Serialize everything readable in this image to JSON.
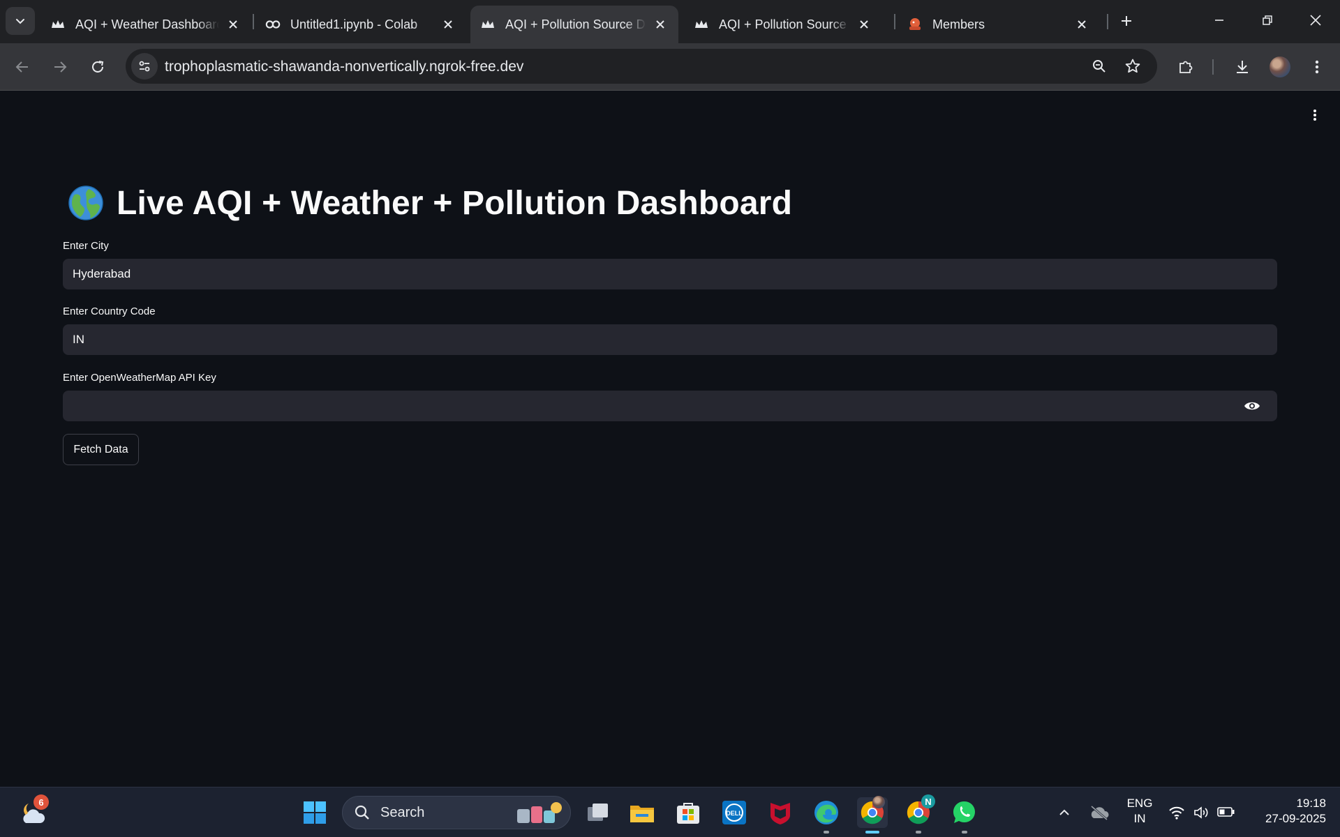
{
  "browser": {
    "tabs": [
      {
        "title": "AQI + Weather Dashboard",
        "icon": "streamlit-crown-icon",
        "active": false
      },
      {
        "title": "Untitled1.ipynb - Colab",
        "icon": "colab-icon",
        "active": false
      },
      {
        "title": "AQI + Pollution Source Dashboard",
        "icon": "streamlit-crown-icon",
        "active": true
      },
      {
        "title": "AQI + Pollution Source Dashboard",
        "icon": "streamlit-crown-icon",
        "active": false
      },
      {
        "title": "Members",
        "icon": "members-icon",
        "active": false
      }
    ],
    "url": "trophoplasmatic-shawanda-nonvertically.ngrok-free.dev"
  },
  "page": {
    "emoji": "globe-icon",
    "title": "Live AQI + Weather + Pollution Dashboard",
    "fields": {
      "city": {
        "label": "Enter City",
        "value": "Hyderabad"
      },
      "country": {
        "label": "Enter Country Code",
        "value": "IN"
      },
      "api_key": {
        "label": "Enter OpenWeatherMap API Key",
        "value": ""
      }
    },
    "fetch_button": "Fetch Data"
  },
  "taskbar": {
    "weather_badge": "6",
    "search_placeholder": "Search",
    "chrome_profile_badge": "N",
    "language": "ENG",
    "region": "IN",
    "time": "19:18",
    "date": "27-09-2025"
  },
  "colors": {
    "page_bg": "#0e1117",
    "input_bg": "#262730",
    "tabstrip_bg": "#202124",
    "toolbar_bg": "#35363a",
    "taskbar_bg": "#1c2230"
  }
}
